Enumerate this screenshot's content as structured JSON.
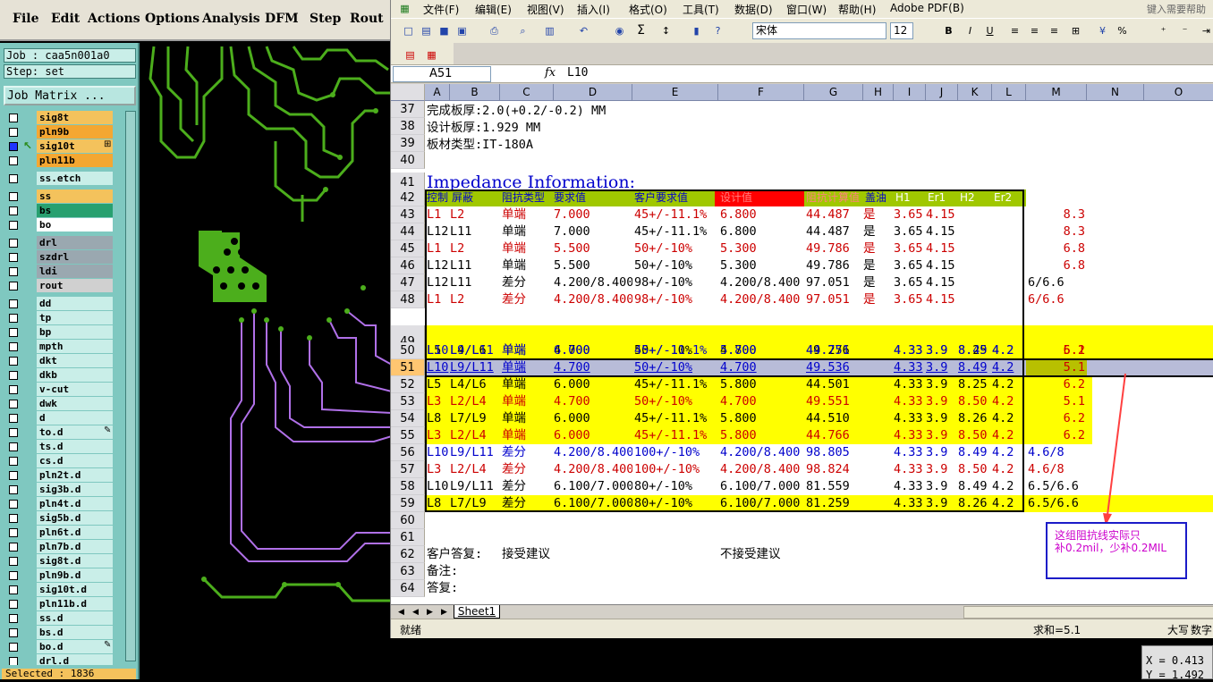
{
  "cam": {
    "menu": [
      "File",
      "Edit",
      "Actions",
      "Options",
      "Analysis",
      "DFM",
      "Step",
      "Rout"
    ],
    "job": "Job : caa5n001a0",
    "step": "Step: set",
    "job_matrix": "Job Matrix ...",
    "layers": [
      {
        "name": "sig8t",
        "bg": "#f4c25c",
        "checked": false
      },
      {
        "name": "pln9b",
        "bg": "#f4a732",
        "checked": false
      },
      {
        "name": "sig10t",
        "bg": "#f4c25c",
        "checked": true,
        "mark": "⊞"
      },
      {
        "name": "pln11b",
        "bg": "#f4a732",
        "checked": false
      },
      {
        "name": "ss.etch",
        "bg": "#c9eee8",
        "checked": false,
        "gap": true
      },
      {
        "name": "ss",
        "bg": "#f4c25c",
        "checked": false,
        "gap": true
      },
      {
        "name": "bs",
        "bg": "#28a070",
        "checked": false
      },
      {
        "name": "bo",
        "bg": "#ffffff",
        "checked": false
      },
      {
        "name": "drl",
        "bg": "#9aa8b0",
        "checked": false,
        "gap": true
      },
      {
        "name": "szdrl",
        "bg": "#9aa8b0",
        "checked": false
      },
      {
        "name": "ldi",
        "bg": "#9aa8b0",
        "checked": false
      },
      {
        "name": "rout",
        "bg": "#d0d0d0",
        "checked": false
      },
      {
        "name": "dd",
        "bg": "#c9eee8",
        "checked": false,
        "gap": true
      },
      {
        "name": "tp",
        "bg": "#c9eee8",
        "checked": false
      },
      {
        "name": "bp",
        "bg": "#c9eee8",
        "checked": false
      },
      {
        "name": "mpth",
        "bg": "#c9eee8",
        "checked": false
      },
      {
        "name": "dkt",
        "bg": "#c9eee8",
        "checked": false
      },
      {
        "name": "dkb",
        "bg": "#c9eee8",
        "checked": false
      },
      {
        "name": "v-cut",
        "bg": "#c9eee8",
        "checked": false
      },
      {
        "name": "dwk",
        "bg": "#c9eee8",
        "checked": false
      },
      {
        "name": "d",
        "bg": "#c9eee8",
        "checked": false
      },
      {
        "name": "to.d",
        "bg": "#c9eee8",
        "checked": false,
        "mark": "✎"
      },
      {
        "name": "ts.d",
        "bg": "#c9eee8",
        "checked": false
      },
      {
        "name": "cs.d",
        "bg": "#c9eee8",
        "checked": false
      },
      {
        "name": "pln2t.d",
        "bg": "#c9eee8",
        "checked": false
      },
      {
        "name": "sig3b.d",
        "bg": "#c9eee8",
        "checked": false
      },
      {
        "name": "pln4t.d",
        "bg": "#c9eee8",
        "checked": false
      },
      {
        "name": "sig5b.d",
        "bg": "#c9eee8",
        "checked": false
      },
      {
        "name": "pln6t.d",
        "bg": "#c9eee8",
        "checked": false
      },
      {
        "name": "pln7b.d",
        "bg": "#c9eee8",
        "checked": false
      },
      {
        "name": "sig8t.d",
        "bg": "#c9eee8",
        "checked": false
      },
      {
        "name": "pln9b.d",
        "bg": "#c9eee8",
        "checked": false
      },
      {
        "name": "sig10t.d",
        "bg": "#c9eee8",
        "checked": false
      },
      {
        "name": "pln11b.d",
        "bg": "#c9eee8",
        "checked": false
      },
      {
        "name": "ss.d",
        "bg": "#c9eee8",
        "checked": false
      },
      {
        "name": "bs.d",
        "bg": "#c9eee8",
        "checked": false
      },
      {
        "name": "bo.d",
        "bg": "#c9eee8",
        "checked": false,
        "mark": "✎"
      },
      {
        "name": "drl.d",
        "bg": "#c9eee8",
        "checked": false
      }
    ],
    "selected": "Selected : 1836",
    "xy_x": "X  = 0.413",
    "xy_y": "Y  = 1.492"
  },
  "excel": {
    "menu": [
      "文件(F)",
      "编辑(E)",
      "视图(V)",
      "插入(I)",
      "格式(O)",
      "工具(T)",
      "数据(D)",
      "窗口(W)",
      "帮助(H)",
      "Adobe PDF(B)"
    ],
    "help_placeholder": "键入需要帮助的",
    "font": "宋体",
    "font_size": "12",
    "name_box": "A51",
    "fx": "fx",
    "formula": "L10",
    "columns": [
      "A",
      "B",
      "C",
      "D",
      "E",
      "F",
      "G",
      "H",
      "I",
      "J",
      "K",
      "L",
      "M",
      "N",
      "O"
    ],
    "sheet_tab": "Sheet1",
    "status": "就绪",
    "sum": "求和=5.1",
    "caps": "大写",
    "num": "数字",
    "headers": {
      "a": "控制",
      "b": "屏蔽",
      "c": "阻抗类型",
      "d": "要求值",
      "e": "客户要求值",
      "f": "设计值",
      "g": "阻抗计算值",
      "h": "盖油",
      "i": "H1",
      "j": "Er1",
      "k": "H2",
      "l": "Er2"
    },
    "info": {
      "r37": "完成板厚:2.0(+0.2/-0.2) MM",
      "r38": "设计板厚:1.929 MM",
      "r39": "板材类型:IT-180A",
      "r41": "Impedance Information:",
      "r62a": "客户答复:",
      "r62b": "接受建议",
      "r62c": "不接受建议",
      "r63": "备注:",
      "r64": "答复:"
    },
    "rows": [
      {
        "n": "43",
        "a": "L1",
        "b": "L2",
        "c": "单端",
        "d": "7.000",
        "e": "45+/-11.1%",
        "f": "6.800",
        "g": "44.487",
        "h": "是",
        "i": "3.65",
        "j": "4.15",
        "k": "",
        "l": "",
        "m": "8.3",
        "color": "#cc0000"
      },
      {
        "n": "44",
        "a": "L12",
        "b": "L11",
        "c": "单端",
        "d": "7.000",
        "e": "45+/-11.1%",
        "f": "6.800",
        "g": "44.487",
        "h": "是",
        "i": "3.65",
        "j": "4.15",
        "k": "",
        "l": "",
        "m": "8.3",
        "color": "#000000"
      },
      {
        "n": "45",
        "a": "L1",
        "b": "L2",
        "c": "单端",
        "d": "5.500",
        "e": "50+/-10%",
        "f": "5.300",
        "g": "49.786",
        "h": "是",
        "i": "3.65",
        "j": "4.15",
        "k": "",
        "l": "",
        "m": "6.8",
        "color": "#cc0000"
      },
      {
        "n": "46",
        "a": "L12",
        "b": "L11",
        "c": "单端",
        "d": "5.500",
        "e": "50+/-10%",
        "f": "5.300",
        "g": "49.786",
        "h": "是",
        "i": "3.65",
        "j": "4.15",
        "k": "",
        "l": "",
        "m": "6.8",
        "color": "#000000"
      },
      {
        "n": "47",
        "a": "L12",
        "b": "L11",
        "c": "差分",
        "d": "4.200/8.400",
        "e": "98+/-10%",
        "f": "4.200/8.400",
        "g": "97.051",
        "h": "是",
        "i": "3.65",
        "j": "4.15",
        "k": "",
        "l": "",
        "m": "6/6.6",
        "color": "#000000"
      },
      {
        "n": "48",
        "a": "L1",
        "b": "L2",
        "c": "差分",
        "d": "4.200/8.400",
        "e": "98+/-10%",
        "f": "4.200/8.400",
        "g": "97.051",
        "h": "是",
        "i": "3.65",
        "j": "4.15",
        "k": "",
        "l": "",
        "m": "6/6.6",
        "color": "#cc0000"
      },
      {
        "n": "49",
        "a": "L5",
        "b": "L4/L6",
        "c": "单端",
        "d": "4.700",
        "e": "50+/-10%",
        "f": "4.700",
        "g": "49.276",
        "h": "",
        "i": "4.33",
        "j": "3.9",
        "k": "8.25",
        "l": "4.2",
        "m": "5.1",
        "color": "#000000"
      },
      {
        "n": "50",
        "a": "L10",
        "b": "L9/L11",
        "c": "单端",
        "d": "6.000",
        "e": "45+/-11.1%",
        "f": "5.800",
        "g": "44.751",
        "h": "",
        "i": "4.33",
        "j": "3.9",
        "k": "8.49",
        "l": "4.2",
        "m": "6.2",
        "color": "#0000cc"
      },
      {
        "n": "51",
        "a": "L10",
        "b": "L9/L11",
        "c": "单端",
        "d": "4.700",
        "e": "50+/-10%",
        "f": "4.700",
        "g": "49.536",
        "h": "",
        "i": "4.33",
        "j": "3.9",
        "k": "8.49",
        "l": "4.2",
        "m": "5.1",
        "color": "#0000cc"
      },
      {
        "n": "52",
        "a": "L5",
        "b": "L4/L6",
        "c": "单端",
        "d": "6.000",
        "e": "45+/-11.1%",
        "f": "5.800",
        "g": "44.501",
        "h": "",
        "i": "4.33",
        "j": "3.9",
        "k": "8.25",
        "l": "4.2",
        "m": "6.2",
        "color": "#000000"
      },
      {
        "n": "53",
        "a": "L3",
        "b": "L2/L4",
        "c": "单端",
        "d": "4.700",
        "e": "50+/-10%",
        "f": "4.700",
        "g": "49.551",
        "h": "",
        "i": "4.33",
        "j": "3.9",
        "k": "8.50",
        "l": "4.2",
        "m": "5.1",
        "color": "#cc0000"
      },
      {
        "n": "54",
        "a": "L8",
        "b": "L7/L9",
        "c": "单端",
        "d": "6.000",
        "e": "45+/-11.1%",
        "f": "5.800",
        "g": "44.510",
        "h": "",
        "i": "4.33",
        "j": "3.9",
        "k": "8.26",
        "l": "4.2",
        "m": "6.2",
        "color": "#000000"
      },
      {
        "n": "55",
        "a": "L3",
        "b": "L2/L4",
        "c": "单端",
        "d": "6.000",
        "e": "45+/-11.1%",
        "f": "5.800",
        "g": "44.766",
        "h": "",
        "i": "4.33",
        "j": "3.9",
        "k": "8.50",
        "l": "4.2",
        "m": "6.2",
        "color": "#cc0000"
      },
      {
        "n": "56",
        "a": "L10",
        "b": "L9/L11",
        "c": "差分",
        "d": "4.200/8.400",
        "e": "100+/-10%",
        "f": "4.200/8.400",
        "g": "98.805",
        "h": "",
        "i": "4.33",
        "j": "3.9",
        "k": "8.49",
        "l": "4.2",
        "m": "4.6/8",
        "color": "#0000cc"
      },
      {
        "n": "57",
        "a": "L3",
        "b": "L2/L4",
        "c": "差分",
        "d": "4.200/8.400",
        "e": "100+/-10%",
        "f": "4.200/8.400",
        "g": "98.824",
        "h": "",
        "i": "4.33",
        "j": "3.9",
        "k": "8.50",
        "l": "4.2",
        "m": "4.6/8",
        "color": "#cc0000"
      },
      {
        "n": "58",
        "a": "L10",
        "b": "L9/L11",
        "c": "差分",
        "d": "6.100/7.000",
        "e": "80+/-10%",
        "f": "6.100/7.000",
        "g": "81.559",
        "h": "",
        "i": "4.33",
        "j": "3.9",
        "k": "8.49",
        "l": "4.2",
        "m": "6.5/6.6",
        "color": "#000000"
      },
      {
        "n": "59",
        "a": "L8",
        "b": "L7/L9",
        "c": "差分",
        "d": "6.100/7.000",
        "e": "80+/-10%",
        "f": "6.100/7.000",
        "g": "81.259",
        "h": "",
        "i": "4.33",
        "j": "3.9",
        "k": "8.26",
        "l": "4.2",
        "m": "6.5/6.6",
        "color": "#000000"
      }
    ],
    "row_numbers": [
      "37",
      "38",
      "39",
      "40",
      "41",
      "42",
      "43",
      "44",
      "45",
      "46",
      "47",
      "48",
      "49",
      "50",
      "51",
      "52",
      "53",
      "54",
      "55",
      "56",
      "57",
      "58",
      "59",
      "60",
      "61",
      "62",
      "63",
      "64"
    ],
    "callout_l1": "这组阻抗线实际只",
    "callout_l2": "补0.2mil，少补0.2MIL"
  }
}
